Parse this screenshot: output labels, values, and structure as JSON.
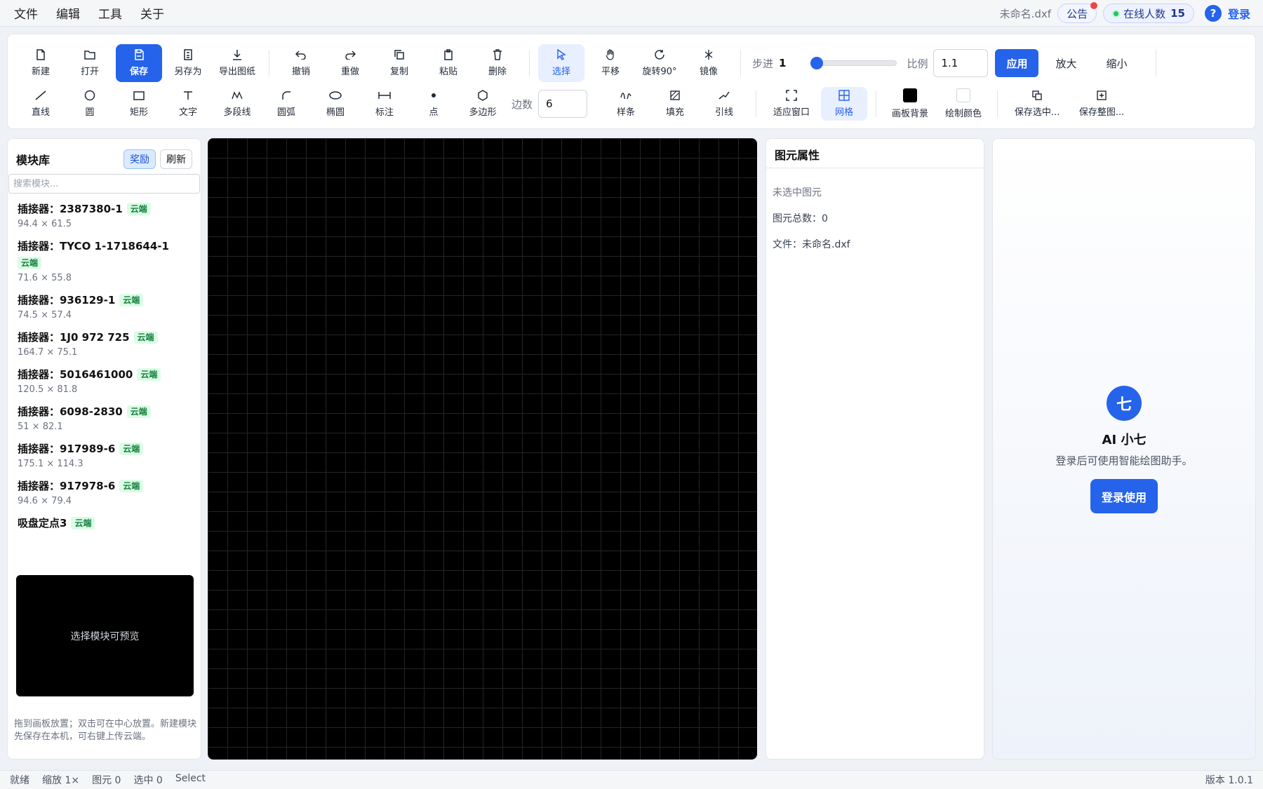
{
  "menu": [
    "文件",
    "编辑",
    "工具",
    "关于"
  ],
  "header": {
    "filename": "未命名.dxf",
    "notice": "公告",
    "online_label": "在线人数",
    "online_count": "15",
    "help": "?",
    "login": "登录"
  },
  "toolbar": {
    "row1": {
      "new": "新建",
      "open": "打开",
      "save": "保存",
      "save_as": "另存为",
      "export": "导出图纸",
      "undo": "撤销",
      "redo": "重做",
      "copy": "复制",
      "paste": "粘贴",
      "delete": "删除",
      "select": "选择",
      "pan": "平移",
      "rotate": "旋转90°",
      "mirror": "镜像",
      "step_label": "步进",
      "step_value": "1",
      "step_slider": 0.0,
      "scale_label": "比例",
      "scale_value": "1.1",
      "apply": "应用",
      "zoom_in": "放大",
      "zoom_out": "缩小"
    },
    "row2": {
      "line": "直线",
      "circle": "圆",
      "rect": "矩形",
      "text": "文字",
      "polyline": "多段线",
      "arc": "圆弧",
      "ellipse": "椭圆",
      "dimension": "标注",
      "point": "点",
      "polygon": "多边形",
      "sides_label": "边数",
      "sides_value": "6",
      "spline": "样条",
      "fill": "填充",
      "leader": "引线",
      "fit": "适应窗口",
      "grid": "网格",
      "bg": "画板背景",
      "draw_color": "绘制颜色",
      "save_sel": "保存选中...",
      "save_all": "保存整图..."
    },
    "colors": {
      "bg_swatch": "#000000",
      "draw_swatch": "#ffffff"
    }
  },
  "module_panel": {
    "title": "模块库",
    "reward": "奖励",
    "refresh": "刷新",
    "search_placeholder": "搜索模块...",
    "items": [
      {
        "name": "插接器：2387380-1",
        "tag": "云端",
        "size": "94.4 × 61.5"
      },
      {
        "name": "插接器：TYCO 1-1718644-1",
        "tag": "云端",
        "size": "71.6 × 55.8"
      },
      {
        "name": "插接器：936129-1",
        "tag": "云端",
        "size": "74.5 × 57.4"
      },
      {
        "name": "插接器：1J0 972 725",
        "tag": "云端",
        "size": "164.7 × 75.1"
      },
      {
        "name": "插接器：5016461000",
        "tag": "云端",
        "size": "120.5 × 81.8"
      },
      {
        "name": "插接器：6098-2830",
        "tag": "云端",
        "size": "51 × 82.1"
      },
      {
        "name": "插接器：917989-6",
        "tag": "云端",
        "size": "175.1 × 114.3"
      },
      {
        "name": "插接器：917978-6",
        "tag": "云端",
        "size": "94.6 × 79.4"
      },
      {
        "name": "吸盘定点3",
        "tag": "云端",
        "size": ""
      }
    ],
    "preview_text": "选择模块可预览",
    "hint": "拖到画板放置；双击可在中心放置。新建模块先保存在本机，可右键上传云端。"
  },
  "properties": {
    "title": "图元属性",
    "none_selected": "未选中图元",
    "total": "图元总数：0",
    "file": "文件：未命名.dxf"
  },
  "ai": {
    "avatar": "七",
    "name": "AI 小七",
    "desc": "登录后可使用智能绘图助手。",
    "login_btn": "登录使用"
  },
  "status": {
    "ready": "就绪",
    "zoom": "缩放 1×",
    "elements": "图元 0",
    "selected": "选中 0",
    "mode": "Select",
    "version": "版本 1.0.1"
  }
}
